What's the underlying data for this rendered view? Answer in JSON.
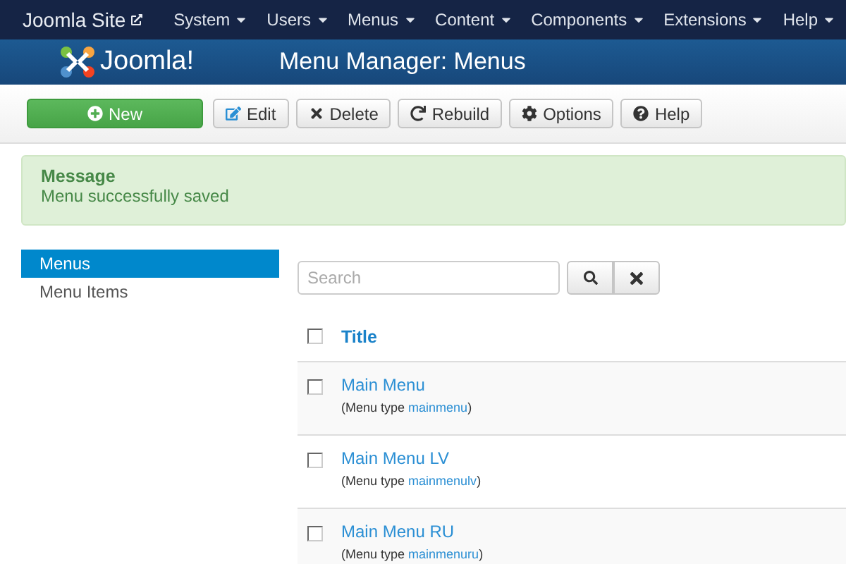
{
  "topnav": {
    "site": "Joomla Site",
    "items": [
      {
        "label": "System"
      },
      {
        "label": "Users"
      },
      {
        "label": "Menus"
      },
      {
        "label": "Content"
      },
      {
        "label": "Components"
      },
      {
        "label": "Extensions"
      },
      {
        "label": "Help"
      }
    ]
  },
  "header": {
    "logo": "Joomla!",
    "title": "Menu Manager: Menus"
  },
  "toolbar": [
    {
      "label": "New",
      "kind": "new"
    },
    {
      "label": "Edit",
      "kind": "edit"
    },
    {
      "label": "Delete",
      "kind": "delete"
    },
    {
      "label": "Rebuild",
      "kind": "rebuild"
    },
    {
      "label": "Options",
      "kind": "options"
    },
    {
      "label": "Help",
      "kind": "help"
    }
  ],
  "message": {
    "heading": "Message",
    "text": "Menu successfully saved"
  },
  "sidebar": [
    {
      "label": "Menus",
      "selected": true
    },
    {
      "label": "Menu Items",
      "selected": false
    }
  ],
  "search": {
    "placeholder": "Search"
  },
  "table": {
    "header": {
      "title": "Title",
      "checked": false
    },
    "rows": [
      {
        "title": "Main Menu",
        "prefix": "(Menu type ",
        "type": "mainmenu",
        "suffix": ")",
        "checked": false
      },
      {
        "title": "Main Menu LV",
        "prefix": "(Menu type ",
        "type": "mainmenulv",
        "suffix": ")",
        "checked": false
      },
      {
        "title": "Main Menu RU",
        "prefix": "(Menu type ",
        "type": "mainmenuru",
        "suffix": ")",
        "checked": false
      }
    ]
  }
}
